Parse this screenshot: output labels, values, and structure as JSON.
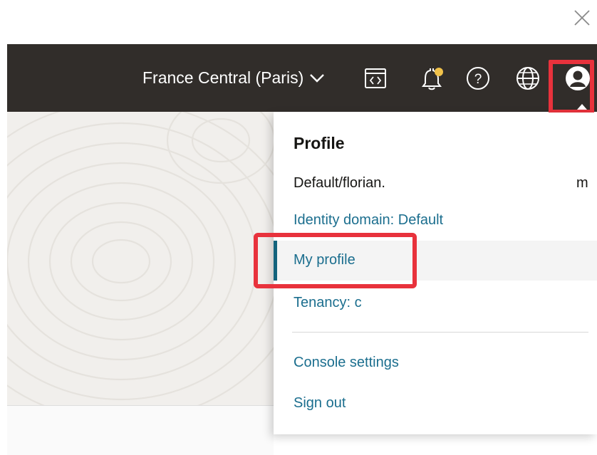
{
  "window": {
    "close_icon": "close-icon"
  },
  "header": {
    "region_label": "France Central (Paris)",
    "region_chevron_icon": "chevron-down-icon",
    "icons": [
      "code-editor-icon",
      "bell-icon",
      "help-icon",
      "globe-icon",
      "profile-avatar-icon"
    ],
    "bar_color": "#312d2a",
    "notification_dot_color": "#f1c24a"
  },
  "profile_menu": {
    "title": "Profile",
    "user_prefix": "Default/florian.",
    "user_suffix": "m",
    "identity_domain": "Identity domain: Default",
    "my_profile": "My profile",
    "tenancy": "Tenancy: c",
    "console_settings": "Console settings",
    "sign_out": "Sign out",
    "link_color": "#1b6e8e"
  },
  "annotations": {
    "highlight_color": "#e8323c"
  }
}
